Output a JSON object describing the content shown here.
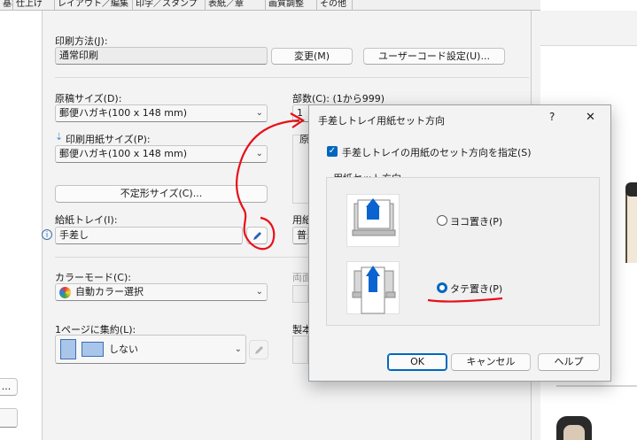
{
  "tabs": [
    "基本",
    "仕上げ",
    "レイアウト／編集",
    "印字／スタンプ",
    "表紙／章",
    "画質調整",
    "その他"
  ],
  "print_method": {
    "label": "印刷方法(J):",
    "value": "通常印刷",
    "change_btn": "変更(M)",
    "user_code_btn": "ユーザーコード設定(U)..."
  },
  "original_size": {
    "label": "原稿サイズ(D):",
    "value": "郵便ハガキ(100 x 148 mm)"
  },
  "paper_size": {
    "label": "印刷用紙サイズ(P):",
    "value": "郵便ハガキ(100 x 148 mm)"
  },
  "custom_size_btn": "不定形サイズ(C)...",
  "copies": {
    "label": "部数(C):",
    "range": "(1から999)",
    "value": "1"
  },
  "paper_tray": {
    "label": "給紙トレイ(I):",
    "value": "手差し"
  },
  "color_mode": {
    "label": "カラーモード(C):",
    "value": "自動カラー選択"
  },
  "nup": {
    "label": "1ページに集約(L):",
    "value": "しない"
  },
  "partial_labels": {
    "gen": "原",
    "yoshi": "用紙",
    "futsu": "普通",
    "ryomen": "両面",
    "seihon": "製本"
  },
  "left_btn_ellipsis": "...",
  "modal": {
    "title": "手差しトレイ用紙セット方向",
    "help": "?",
    "close": "✕",
    "checkbox_label": "手差しトレイの用紙のセット方向を指定(S)",
    "group_title": "用紙セット方向",
    "option_yoko": "ヨコ置き(P)",
    "option_tate": "タテ置き(P)",
    "ok": "OK",
    "cancel": "キャンセル",
    "help_btn": "ヘルプ"
  },
  "colors": {
    "accent": "#0067c0",
    "annotation": "#e8101a"
  },
  "icons": {
    "info": "info-icon",
    "edit": "pencil-icon",
    "dropdown": "chevron-down-icon"
  }
}
